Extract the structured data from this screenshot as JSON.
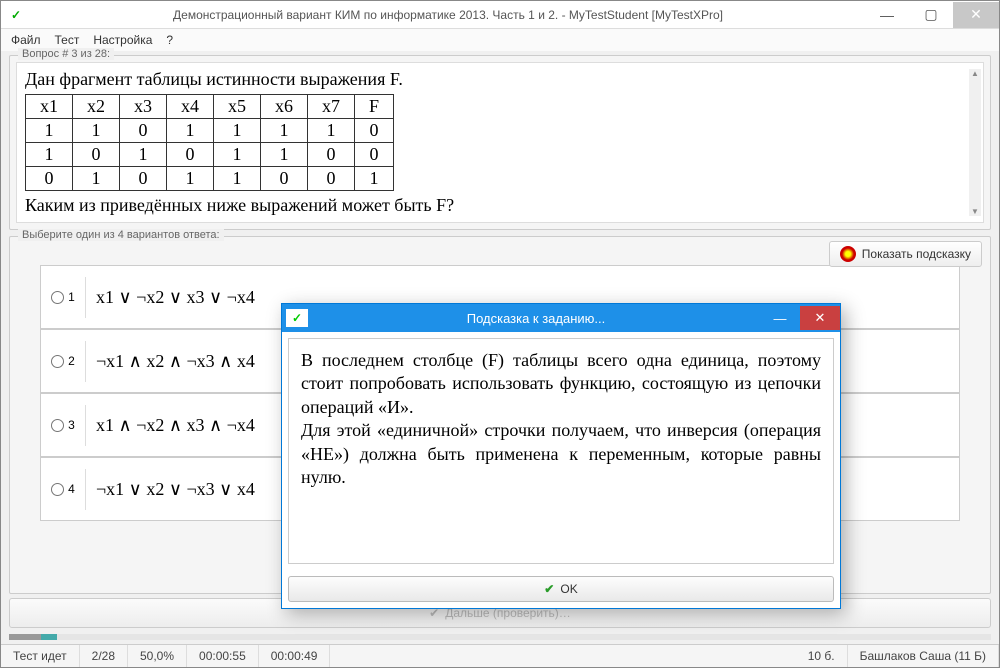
{
  "titlebar": {
    "title": "Демонстрационный вариант КИМ по информатике 2013. Часть 1 и 2. - MyTestStudent [MyTestXPro]"
  },
  "menu": {
    "file": "Файл",
    "test": "Тест",
    "settings": "Настройка",
    "help": "?"
  },
  "question": {
    "frame_label": "Вопрос # 3 из 28:",
    "intro": "Дан фрагмент таблицы истинности выражения F.",
    "outro": "Каким из приведённых ниже выражений может быть F?",
    "headers": [
      "x1",
      "x2",
      "x3",
      "x4",
      "x5",
      "x6",
      "x7",
      "F"
    ],
    "rows": [
      [
        "1",
        "1",
        "0",
        "1",
        "1",
        "1",
        "1",
        "0"
      ],
      [
        "1",
        "0",
        "1",
        "0",
        "1",
        "1",
        "0",
        "0"
      ],
      [
        "0",
        "1",
        "0",
        "1",
        "1",
        "0",
        "0",
        "1"
      ]
    ]
  },
  "answers": {
    "frame_label": "Выберите один из 4 вариантов ответа:",
    "hint_btn": "Показать подсказку",
    "items": [
      {
        "num": "1",
        "text": "x1 ∨ ¬x2 ∨ x3 ∨ ¬x4"
      },
      {
        "num": "2",
        "text": "¬x1 ∧ x2 ∧ ¬x3 ∧ x4"
      },
      {
        "num": "3",
        "text": "x1 ∧ ¬x2 ∧ x3 ∧ ¬x4"
      },
      {
        "num": "4",
        "text": "¬x1 ∨ x2 ∨ ¬x3 ∨ x4"
      }
    ]
  },
  "next_label": "Дальше (проверить)…",
  "status": {
    "state": "Тест идет",
    "prog": "2/28",
    "pct": "50,0%",
    "t1": "00:00:55",
    "t2": "00:00:49",
    "score": "10 б.",
    "user": "Башлаков Саша (11 Б)"
  },
  "modal": {
    "title": "Подсказка к заданию...",
    "body1": "В последнем столбце (F) таблицы всего одна единица, поэтому стоит попробовать использовать функцию, состоящую из цепочки операций «И».",
    "body2": "Для этой «единичной» строчки получаем, что инверсия (операция «НЕ») должна быть применена к переменным, которые равны нулю.",
    "ok": "OK"
  }
}
